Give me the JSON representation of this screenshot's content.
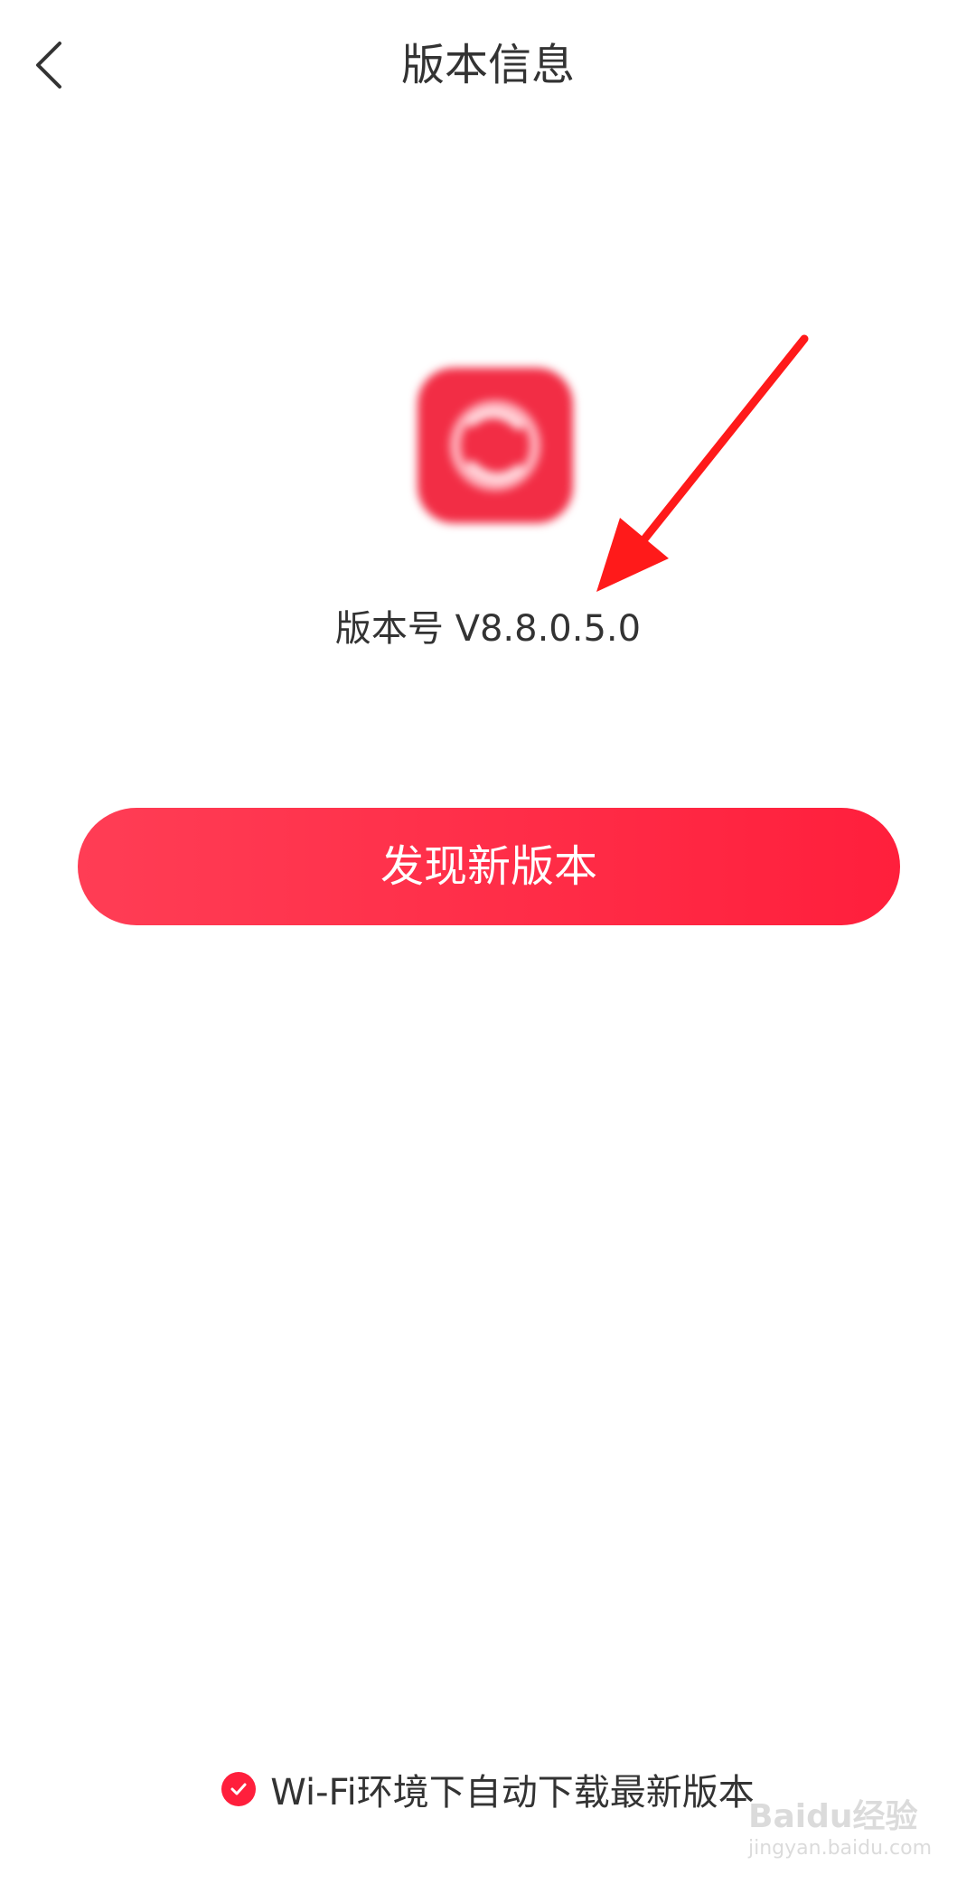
{
  "header": {
    "title": "版本信息",
    "back_icon": "chevron-left-icon"
  },
  "app": {
    "icon": "app-logo-icon",
    "version_text": "版本号 V8.8.0.5.0"
  },
  "update_button": {
    "label": "发现新版本"
  },
  "auto_download": {
    "checked": true,
    "label": "Wi-Fi环境下自动下载最新版本"
  },
  "watermark": {
    "text": "Baidu经验",
    "url": "jingyan.baidu.com"
  },
  "colors": {
    "accent": "#ff1f3c",
    "text": "#333333"
  }
}
